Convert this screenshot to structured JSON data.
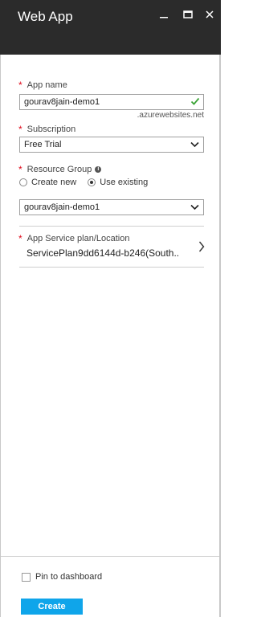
{
  "window": {
    "title": "Web App"
  },
  "form": {
    "app_name": {
      "label": "App name",
      "value": "gourav8jain-demo1",
      "suffix": ".azurewebsites.net",
      "valid": true
    },
    "subscription": {
      "label": "Subscription",
      "selected": "Free Trial"
    },
    "resource_group": {
      "label": "Resource Group",
      "options": [
        "Create new",
        "Use existing"
      ],
      "selected_option": "Use existing",
      "selected": "gourav8jain-demo1"
    },
    "app_service_plan": {
      "label": "App Service plan/Location",
      "value": "ServicePlan9dd6144d-b246(South.."
    }
  },
  "footer": {
    "pin_label": "Pin to dashboard",
    "pin_checked": false,
    "create_label": "Create"
  },
  "colors": {
    "titlebar": "#2b2b2b",
    "required": "#e00b1c",
    "valid": "#3aa335",
    "create": "#0fa5ea"
  }
}
